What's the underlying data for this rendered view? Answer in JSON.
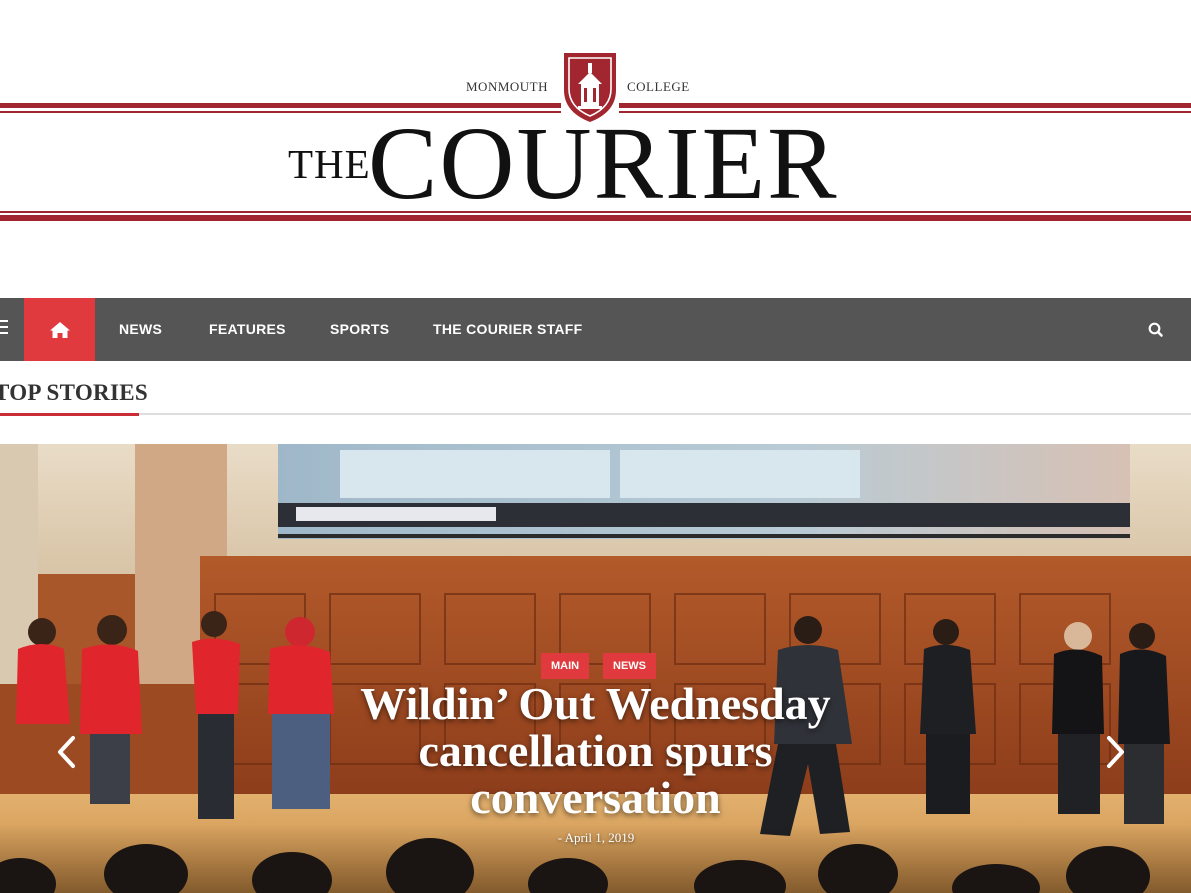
{
  "masthead": {
    "left_small": "MONMOUTH",
    "right_small": "COLLEGE",
    "the": "THE",
    "courier": "COURIER",
    "brand_color": "#a2262f"
  },
  "nav": {
    "home_icon": "home-icon",
    "items": [
      {
        "label": "NEWS"
      },
      {
        "label": "FEATURES"
      },
      {
        "label": "SPORTS"
      },
      {
        "label": "THE COURIER STAFF"
      }
    ],
    "search_icon": "search-icon",
    "menu_icon": "hamburger-menu-icon",
    "bar_color": "#555555",
    "accent_color": "#e03a3e"
  },
  "section": {
    "title": "TOP STORIES"
  },
  "slider": {
    "categories": [
      "MAIN",
      "NEWS"
    ],
    "headline": "Wildin’ Out Wednesday cancellation spurs conversation",
    "date": "- April 1, 2019",
    "prev_icon": "chevron-left-icon",
    "next_icon": "chevron-right-icon"
  }
}
